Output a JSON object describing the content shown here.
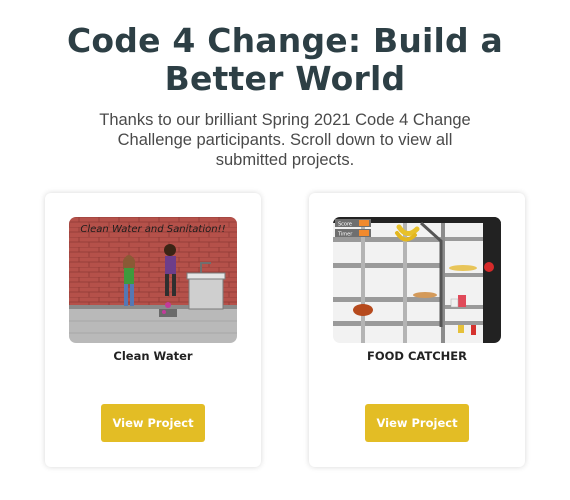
{
  "page": {
    "title_line1": "Code 4 Change: Build a",
    "title_line2": "Better World",
    "subtitle_line1": "Thanks to our brilliant Spring 2021 Code 4 Change",
    "subtitle_line2": "Challenge participants. Scroll down to view all",
    "subtitle_line3": "submitted projects."
  },
  "projects": [
    {
      "title": "Clean Water",
      "thumbnail_caption": "Clean Water and Sanitation!!",
      "button_label": "View Project"
    },
    {
      "title": "FOOD CATCHER",
      "thumbnail_score_label": "Score",
      "thumbnail_timer_label": "Timer",
      "button_label": "View Project"
    }
  ],
  "colors": {
    "heading": "#2d3f45",
    "button": "#e3bd25",
    "button_text": "#ffffff"
  }
}
